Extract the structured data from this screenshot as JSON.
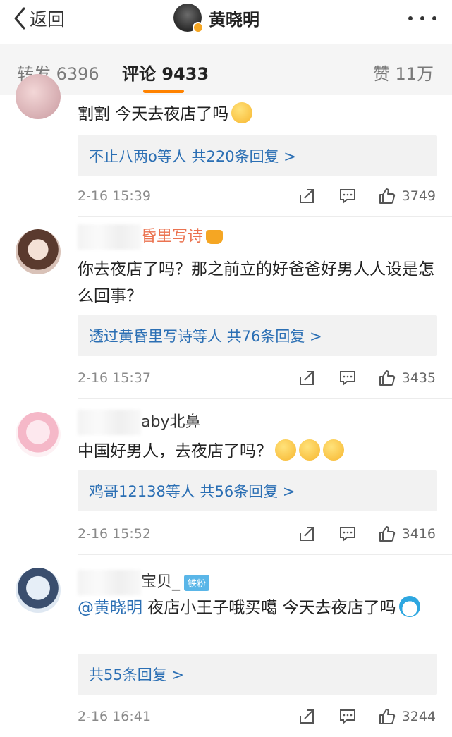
{
  "header": {
    "back_label": "返回",
    "title": "黄晓明"
  },
  "tabs": {
    "repost": "转发 6396",
    "comments": "评论 9433",
    "likes": "赞 11万"
  },
  "colors": {
    "accent": "#ff8200",
    "link": "#2b6fb4",
    "name": "#eb7350"
  },
  "comments": [
    {
      "name": "",
      "text": "割割 今天去夜店了吗",
      "reply_summary": "不止八两o等人 共220条回复 >",
      "time": "2-16 15:39",
      "likes": "3749"
    },
    {
      "name": "昏里写诗",
      "text": "你去夜店了吗？那之前立的好爸爸好男人人设是怎么回事？",
      "reply_summary": "透过黄昏里写诗等人 共76条回复 >",
      "time": "2-16 15:37",
      "likes": "3435"
    },
    {
      "name": "aby北鼻",
      "text": "中国好男人，去夜店了吗？",
      "reply_summary": "鸡哥12138等人 共56条回复 >",
      "time": "2-16 15:52",
      "likes": "3416"
    },
    {
      "name": "宝贝_",
      "badge": "铁粉",
      "mention": "@黄晓明",
      "text": " 夜店小王子哦买噶 今天去夜店了吗",
      "reply_summary": "共55条回复 >",
      "time": "2-16 16:41",
      "likes": "3244"
    }
  ]
}
